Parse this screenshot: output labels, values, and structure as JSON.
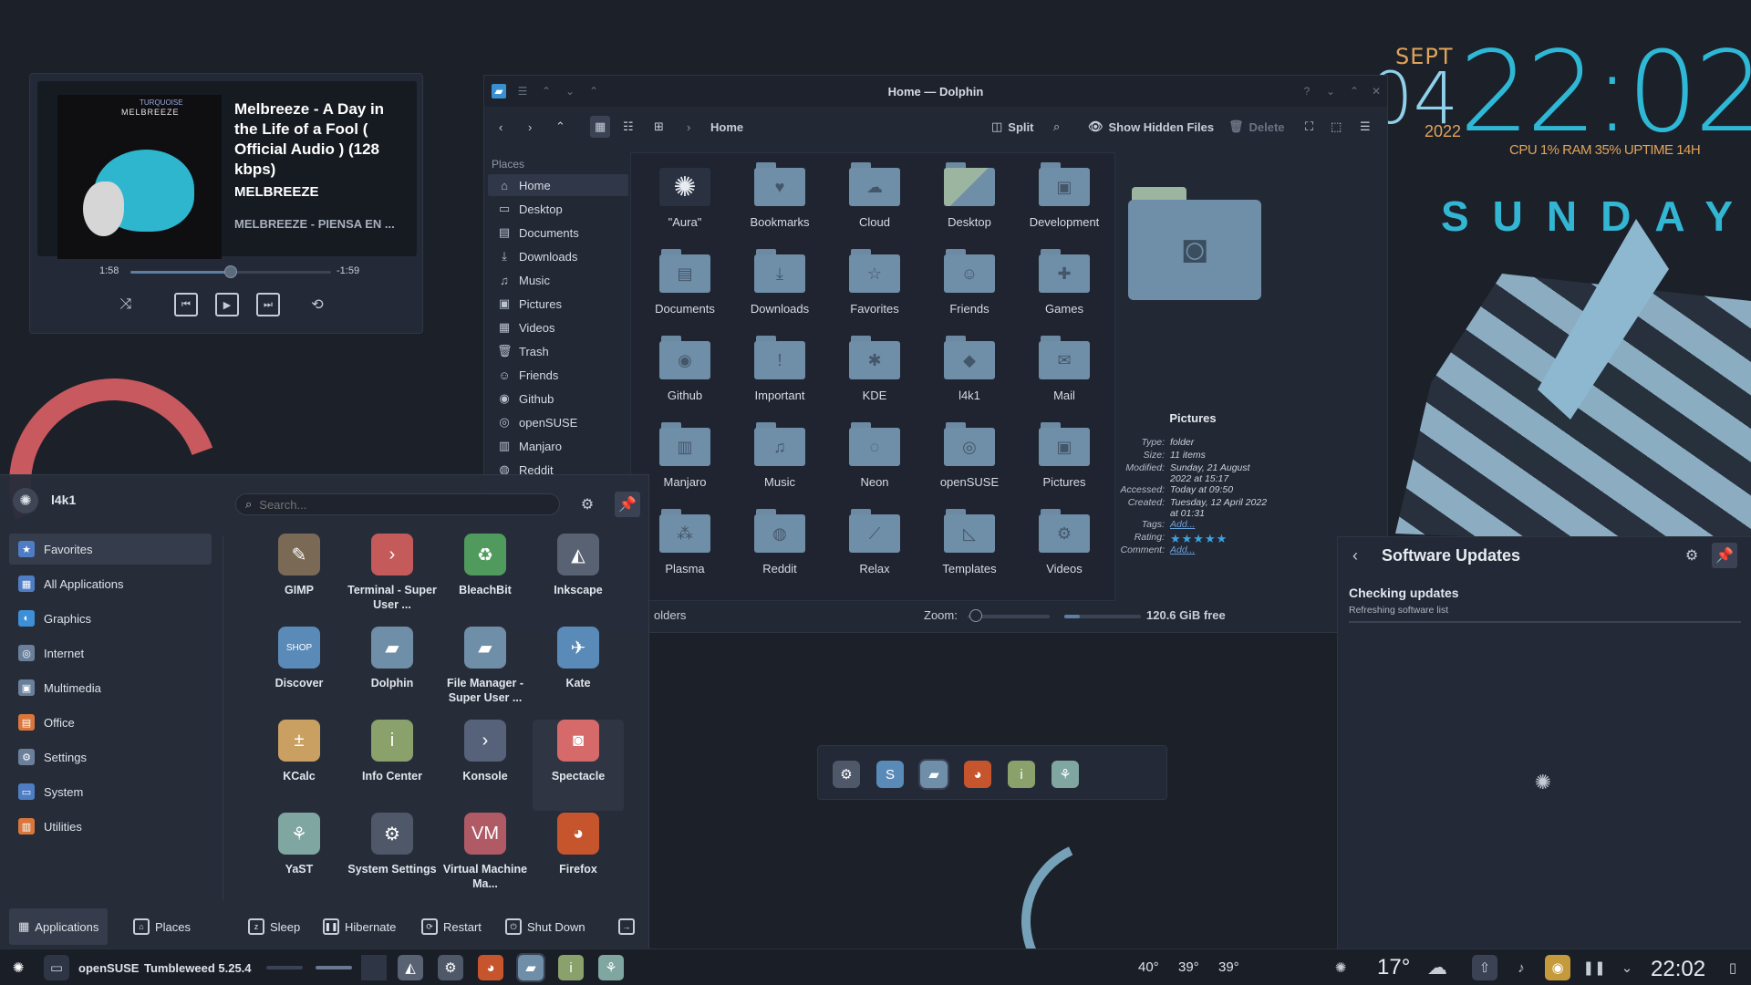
{
  "clock": {
    "month": "SEPT",
    "day": "04",
    "year": "2022",
    "time": "22:02",
    "stats": "CPU 1% RAM 35% UPTIME 14H",
    "weekday": "SUNDAY"
  },
  "media": {
    "title": "Melbreeze - A Day in the Life of a Fool ( Official Audio ) (128 kbps)",
    "artist": "MELBREEZE",
    "album": "MELBREEZE - PIENSA EN ...",
    "cover_text_1": "MELBREEZE",
    "cover_text_2": "TURQUOISE",
    "elapsed": "1:58",
    "remaining": "-1:59",
    "progress_fraction": 0.5
  },
  "dolphin": {
    "window_title": "Home — Dolphin",
    "breadcrumb": "Home",
    "toolbar": {
      "split": "Split",
      "show_hidden": "Show Hidden Files",
      "delete": "Delete"
    },
    "places_header": "Places",
    "places": [
      {
        "label": "Home",
        "icon": "home-icon",
        "glyph": "⌂"
      },
      {
        "label": "Desktop",
        "icon": "desktop-icon",
        "glyph": "▭"
      },
      {
        "label": "Documents",
        "icon": "documents-icon",
        "glyph": "▤"
      },
      {
        "label": "Downloads",
        "icon": "downloads-icon",
        "glyph": "⤓"
      },
      {
        "label": "Music",
        "icon": "music-icon",
        "glyph": "♫"
      },
      {
        "label": "Pictures",
        "icon": "pictures-icon",
        "glyph": "▣"
      },
      {
        "label": "Videos",
        "icon": "videos-icon",
        "glyph": "▦"
      },
      {
        "label": "Trash",
        "icon": "trash-icon",
        "glyph": "🗑"
      },
      {
        "label": "Friends",
        "icon": "friends-icon",
        "glyph": "☺"
      },
      {
        "label": "Github",
        "icon": "github-icon",
        "glyph": "◉"
      },
      {
        "label": "openSUSE",
        "icon": "opensuse-icon",
        "glyph": "◎"
      },
      {
        "label": "Manjaro",
        "icon": "manjaro-icon",
        "glyph": "▥"
      },
      {
        "label": "Reddit",
        "icon": "reddit-icon",
        "glyph": "◍"
      }
    ],
    "folders": [
      {
        "name": "\"Aura\"",
        "glyph": "✺"
      },
      {
        "name": "Bookmarks",
        "glyph": "♥"
      },
      {
        "name": "Cloud",
        "glyph": "☁"
      },
      {
        "name": "Desktop",
        "glyph": ""
      },
      {
        "name": "Development",
        "glyph": "▣"
      },
      {
        "name": "Documents",
        "glyph": "▤"
      },
      {
        "name": "Downloads",
        "glyph": "⤓"
      },
      {
        "name": "Favorites",
        "glyph": "☆"
      },
      {
        "name": "Friends",
        "glyph": "☺"
      },
      {
        "name": "Games",
        "glyph": "✚"
      },
      {
        "name": "Github",
        "glyph": "◉"
      },
      {
        "name": "Important",
        "glyph": "!"
      },
      {
        "name": "KDE",
        "glyph": "✱"
      },
      {
        "name": "l4k1",
        "glyph": "◆"
      },
      {
        "name": "Mail",
        "glyph": "✉"
      },
      {
        "name": "Manjaro",
        "glyph": "▥"
      },
      {
        "name": "Music",
        "glyph": "♫"
      },
      {
        "name": "Neon",
        "glyph": "◌"
      },
      {
        "name": "openSUSE",
        "glyph": "◎"
      },
      {
        "name": "Pictures",
        "glyph": "▣"
      },
      {
        "name": "Plasma",
        "glyph": "⁂"
      },
      {
        "name": "Reddit",
        "glyph": "◍"
      },
      {
        "name": "Relax",
        "glyph": "⟋"
      },
      {
        "name": "Templates",
        "glyph": "◺"
      },
      {
        "name": "Videos",
        "glyph": "⚙"
      }
    ],
    "info": {
      "title": "Pictures",
      "rows": [
        {
          "k": "Type:",
          "v": "folder"
        },
        {
          "k": "Size:",
          "v": "11 items"
        },
        {
          "k": "Modified:",
          "v": "Sunday, 21 August 2022 at 15:17"
        },
        {
          "k": "Accessed:",
          "v": "Today at 09:50"
        },
        {
          "k": "Created:",
          "v": "Tuesday, 12 April 2022 at 01:31"
        },
        {
          "k": "Tags:",
          "v": "Add..."
        },
        {
          "k": "Rating:",
          "v": "★★★★★"
        },
        {
          "k": "Comment:",
          "v": "Add..."
        }
      ],
      "rating": 5
    },
    "status": {
      "left": "olders",
      "zoom_label": "Zoom:",
      "free_space": "120.6 GiB free",
      "zoom_fraction": 0.1,
      "space_used_fraction": 0.2
    }
  },
  "updates": {
    "title": "Software Updates",
    "status": "Checking updates",
    "detail": "Refreshing software list"
  },
  "launcher": {
    "user": "l4k1",
    "search_placeholder": "Search...",
    "categories": [
      {
        "label": "Favorites",
        "icon": "favorites-icon",
        "color": "#4f7dc4",
        "glyph": "★"
      },
      {
        "label": "All Applications",
        "icon": "all-apps-icon",
        "color": "#4f7dc4",
        "glyph": "▦"
      },
      {
        "label": "Graphics",
        "icon": "graphics-icon",
        "color": "#3f8fd6",
        "glyph": "◐"
      },
      {
        "label": "Internet",
        "icon": "internet-icon",
        "color": "#6a7f9a",
        "glyph": "◎"
      },
      {
        "label": "Multimedia",
        "icon": "multimedia-icon",
        "color": "#6a7f9a",
        "glyph": "▣"
      },
      {
        "label": "Office",
        "icon": "office-icon",
        "color": "#d9763c",
        "glyph": "▤"
      },
      {
        "label": "Settings",
        "icon": "settings-icon",
        "color": "#6a7f9a",
        "glyph": "⚙"
      },
      {
        "label": "System",
        "icon": "system-icon",
        "color": "#4f7dc4",
        "glyph": "▭"
      },
      {
        "label": "Utilities",
        "icon": "utilities-icon",
        "color": "#d9763c",
        "glyph": "▥"
      }
    ],
    "apps": [
      {
        "name": "GIMP",
        "icon": "gimp-icon",
        "color": "#7a6a55",
        "glyph": "✎"
      },
      {
        "name": "Terminal - Super User ...",
        "icon": "terminal-icon",
        "color": "#c45a5a",
        "glyph": "›"
      },
      {
        "name": "BleachBit",
        "icon": "bleachbit-icon",
        "color": "#4f9a5c",
        "glyph": "♻"
      },
      {
        "name": "Inkscape",
        "icon": "inkscape-icon",
        "color": "#586273",
        "glyph": "◭"
      },
      {
        "name": "Discover",
        "icon": "discover-icon",
        "color": "#5a8ab8",
        "glyph": "SHOP"
      },
      {
        "name": "Dolphin",
        "icon": "dolphin-icon",
        "color": "#6f8ea8",
        "glyph": "▰"
      },
      {
        "name": "File Manager - Super User ...",
        "icon": "file-manager-icon",
        "color": "#6f8ea8",
        "glyph": "▰"
      },
      {
        "name": "Kate",
        "icon": "kate-icon",
        "color": "#5a8ab8",
        "glyph": "✈"
      },
      {
        "name": "KCalc",
        "icon": "kcalc-icon",
        "color": "#c9a061",
        "glyph": "±"
      },
      {
        "name": "Info Center",
        "icon": "info-center-icon",
        "color": "#8aa16b",
        "glyph": "i"
      },
      {
        "name": "Konsole",
        "icon": "konsole-icon",
        "color": "#56627a",
        "glyph": "›"
      },
      {
        "name": "Spectacle",
        "icon": "spectacle-icon",
        "color": "#d66a6a",
        "glyph": "◙"
      },
      {
        "name": "YaST",
        "icon": "yast-icon",
        "color": "#7fa6a0",
        "glyph": "⚘"
      },
      {
        "name": "System Settings",
        "icon": "system-settings-icon",
        "color": "#4f5868",
        "glyph": "⚙"
      },
      {
        "name": "Virtual Machine Ma...",
        "icon": "virt-manager-icon",
        "color": "#b05a66",
        "glyph": "VM"
      },
      {
        "name": "Firefox",
        "icon": "firefox-icon",
        "color": "#c6552e",
        "glyph": "◕"
      }
    ],
    "footer": {
      "applications": "Applications",
      "places": "Places",
      "sleep": "Sleep",
      "hibernate": "Hibernate",
      "restart": "Restart",
      "shutdown": "Shut Down"
    }
  },
  "dock": {
    "items": [
      {
        "icon": "system-settings-icon",
        "color": "#4f5868",
        "glyph": "⚙"
      },
      {
        "icon": "discover-icon",
        "color": "#5a8ab8",
        "glyph": "S"
      },
      {
        "icon": "dolphin-icon",
        "color": "#6f8ea8",
        "glyph": "▰"
      },
      {
        "icon": "firefox-icon",
        "color": "#c6552e",
        "glyph": "◕"
      },
      {
        "icon": "info-center-icon",
        "color": "#8aa16b",
        "glyph": "i"
      },
      {
        "icon": "yast-icon",
        "color": "#7fa6a0",
        "glyph": "⚘"
      }
    ]
  },
  "taskbar": {
    "distro": "openSUSE",
    "version": "Tumbleweed 5.25.4",
    "temps": [
      "40°",
      "39°",
      "39°"
    ],
    "weather_temp": "17°",
    "clock": "22:02"
  }
}
